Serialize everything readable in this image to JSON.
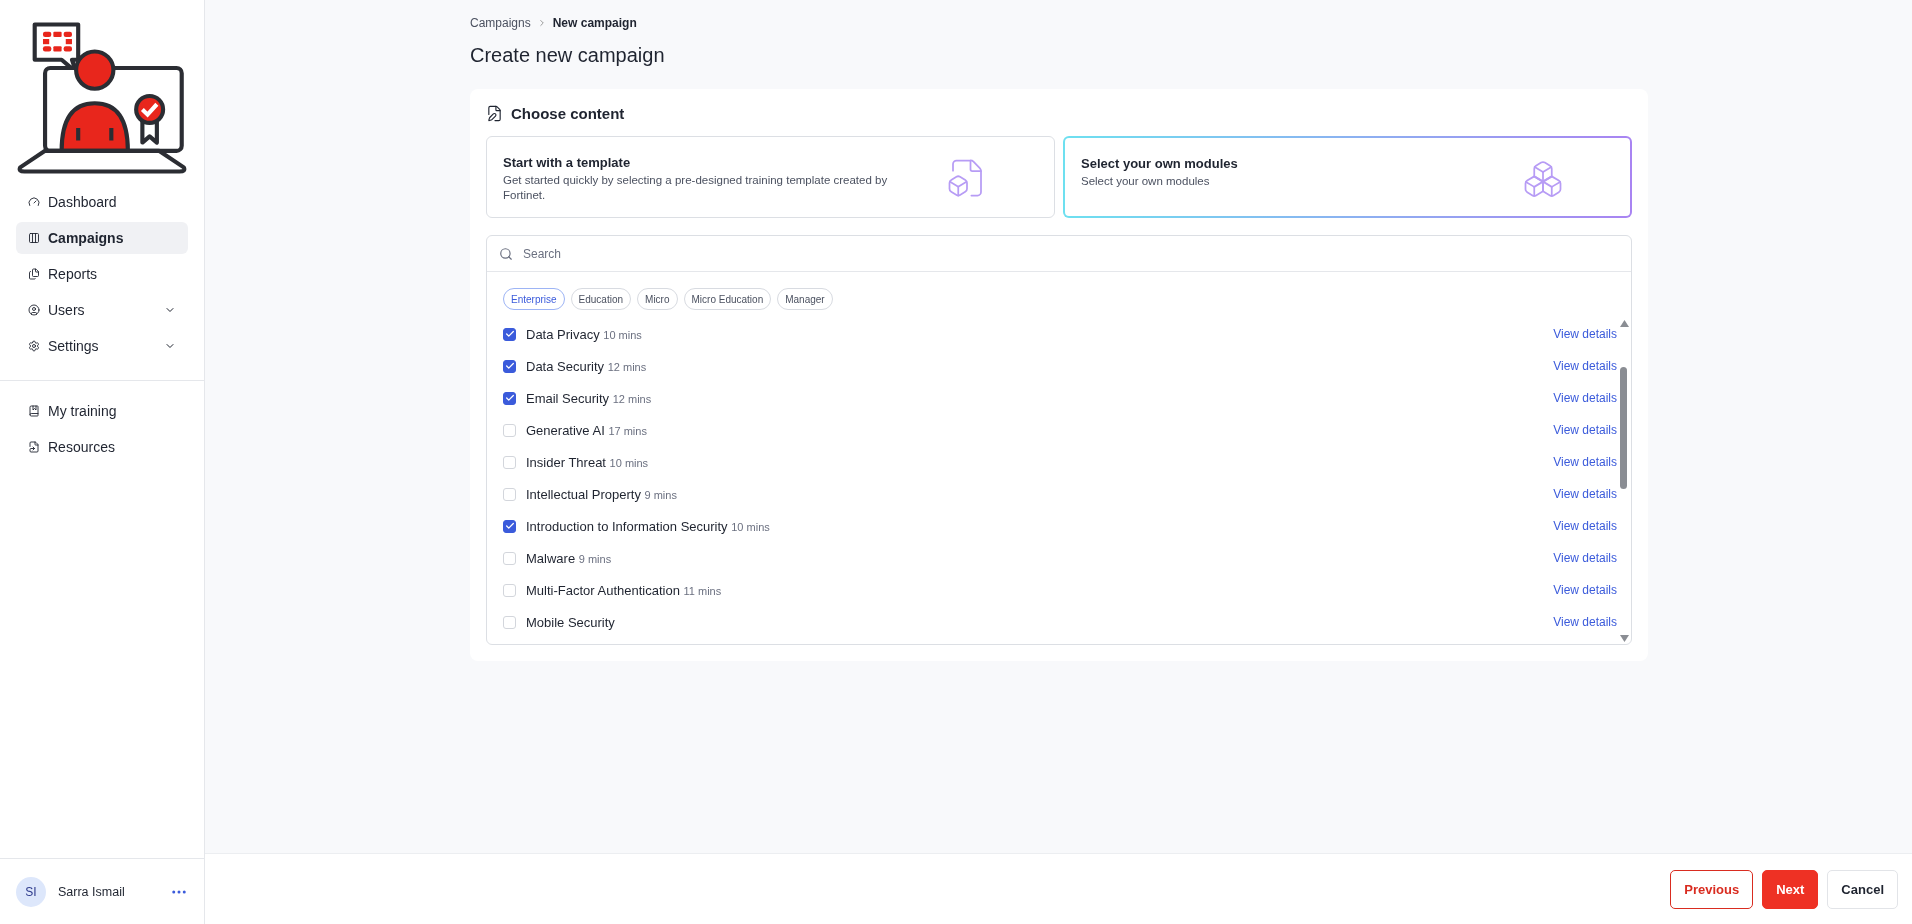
{
  "sidebar": {
    "items": [
      {
        "label": "Dashboard",
        "selected": false,
        "expandable": false
      },
      {
        "label": "Campaigns",
        "selected": true,
        "expandable": false
      },
      {
        "label": "Reports",
        "selected": false,
        "expandable": false
      },
      {
        "label": "Users",
        "selected": false,
        "expandable": true
      },
      {
        "label": "Settings",
        "selected": false,
        "expandable": true
      }
    ],
    "secondary_items": [
      {
        "label": "My training",
        "selected": false
      },
      {
        "label": "Resources",
        "selected": false
      }
    ],
    "user": {
      "initials": "SI",
      "name": "Sarra Ismail"
    }
  },
  "breadcrumb": [
    "Campaigns",
    "New campaign"
  ],
  "page_title": "Create new campaign",
  "section_title": "Choose content",
  "options": [
    {
      "title": "Start with a template",
      "description": "Get started quickly by selecting a pre-designed training template created by Fortinet.",
      "selected": false
    },
    {
      "title": "Select your own modules",
      "description": "Select your own modules",
      "selected": true
    }
  ],
  "search": {
    "placeholder": "Search"
  },
  "filters": [
    {
      "label": "Enterprise",
      "selected": true
    },
    {
      "label": "Education",
      "selected": false
    },
    {
      "label": "Micro",
      "selected": false
    },
    {
      "label": "Micro Education",
      "selected": false
    },
    {
      "label": "Manager",
      "selected": false
    }
  ],
  "modules": [
    {
      "name": "Data Privacy",
      "duration": "10 mins",
      "checked": true,
      "link": "View details"
    },
    {
      "name": "Data Security",
      "duration": "12 mins",
      "checked": true,
      "link": "View details"
    },
    {
      "name": "Email Security",
      "duration": "12 mins",
      "checked": true,
      "link": "View details"
    },
    {
      "name": "Generative AI",
      "duration": "17 mins",
      "checked": false,
      "link": "View details"
    },
    {
      "name": "Insider Threat",
      "duration": "10 mins",
      "checked": false,
      "link": "View details"
    },
    {
      "name": "Intellectual Property",
      "duration": "9 mins",
      "checked": false,
      "link": "View details"
    },
    {
      "name": "Introduction to Information Security",
      "duration": "10 mins",
      "checked": true,
      "link": "View details"
    },
    {
      "name": "Malware",
      "duration": "9 mins",
      "checked": false,
      "link": "View details"
    },
    {
      "name": "Multi-Factor Authentication",
      "duration": "11 mins",
      "checked": false,
      "link": "View details"
    },
    {
      "name": "Mobile Security",
      "checked": false,
      "link": "View details"
    }
  ],
  "footer": {
    "buttons": [
      {
        "label": "Previous",
        "kind": "secondary"
      },
      {
        "label": "Next",
        "kind": "primary"
      },
      {
        "label": "Cancel",
        "kind": "plain"
      }
    ]
  }
}
